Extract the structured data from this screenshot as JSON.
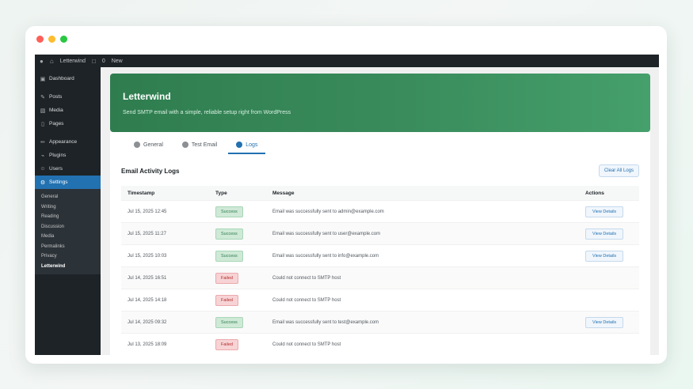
{
  "window": {
    "traffic_lights": [
      {
        "name": "close",
        "color": "#ff5f57"
      },
      {
        "name": "minimize",
        "color": "#febc2e"
      },
      {
        "name": "maximize",
        "color": "#28c840"
      }
    ]
  },
  "adminbar": {
    "site_name": "Letterwind",
    "comments": "0",
    "new": "New"
  },
  "sidebar": {
    "items": [
      {
        "label": "Dashboard",
        "icon": "dashboard-icon"
      },
      {
        "label": "Posts",
        "icon": "pin-icon"
      },
      {
        "label": "Media",
        "icon": "media-icon"
      },
      {
        "label": "Pages",
        "icon": "page-icon"
      },
      {
        "label": "Appearance",
        "icon": "brush-icon"
      },
      {
        "label": "Plugins",
        "icon": "plug-icon"
      },
      {
        "label": "Users",
        "icon": "user-icon"
      },
      {
        "label": "Settings",
        "icon": "settings-icon"
      }
    ],
    "submenu": [
      "General",
      "Writing",
      "Reading",
      "Discussion",
      "Media",
      "Permalinks",
      "Privacy",
      "Letterwind"
    ]
  },
  "hero": {
    "title": "Letterwind",
    "subtitle": "Send SMTP email with a simple, reliable setup right from WordPress"
  },
  "tabs": [
    {
      "label": "General"
    },
    {
      "label": "Test Email"
    },
    {
      "label": "Logs"
    }
  ],
  "logs": {
    "title": "Email Activity Logs",
    "clear_label": "Clear All Logs",
    "columns": [
      "Timestamp",
      "Type",
      "Message",
      "Actions"
    ],
    "rows": [
      {
        "timestamp": "Jul 15, 2025 12:45",
        "status": "Success",
        "kind": "sent",
        "message": "Email was successfully sent to admin@example.com",
        "action": "View Details"
      },
      {
        "timestamp": "Jul 15, 2025 11:27",
        "status": "Success",
        "kind": "sent",
        "message": "Email was successfully sent to user@example.com",
        "action": "View Details"
      },
      {
        "timestamp": "Jul 15, 2025 10:03",
        "status": "Success",
        "kind": "sent",
        "message": "Email was successfully sent to info@example.com",
        "action": "View Details"
      },
      {
        "timestamp": "Jul 14, 2025 16:51",
        "status": "Failed",
        "kind": "fail",
        "message": "Could not connect to SMTP host",
        "action": ""
      },
      {
        "timestamp": "Jul 14, 2025 14:18",
        "status": "Failed",
        "kind": "fail",
        "message": "Could not connect to SMTP host",
        "action": ""
      },
      {
        "timestamp": "Jul 14, 2025 09:32",
        "status": "Success",
        "kind": "sent",
        "message": "Email was successfully sent to test@example.com",
        "action": "View Details"
      },
      {
        "timestamp": "Jul 13, 2025 18:09",
        "status": "Failed",
        "kind": "fail",
        "message": "Could not connect to SMTP host",
        "action": ""
      }
    ]
  }
}
